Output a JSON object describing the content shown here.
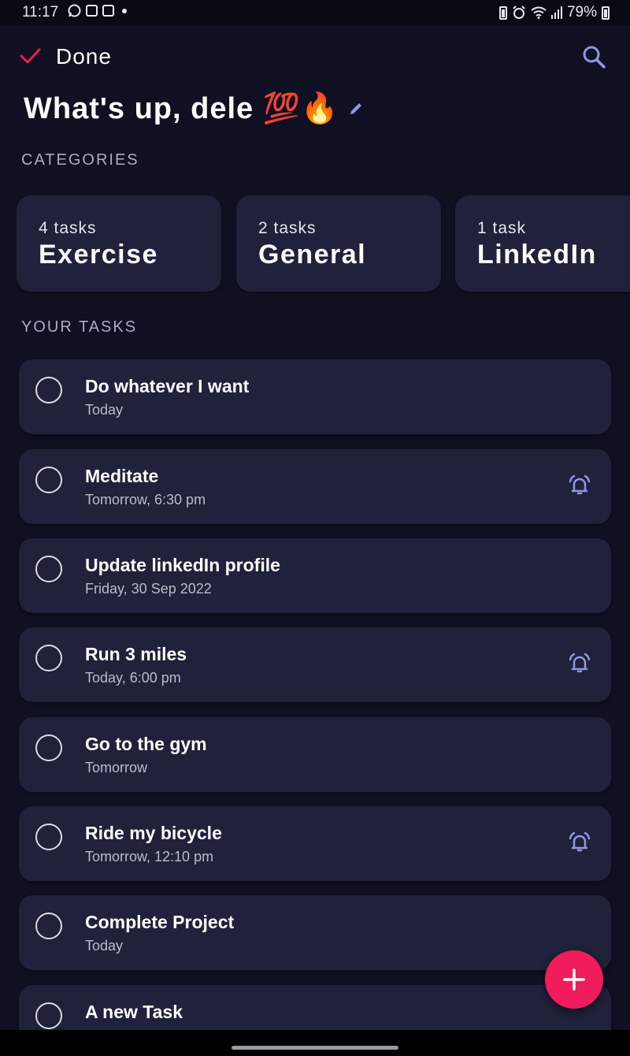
{
  "status_bar": {
    "time": "11:17",
    "battery": "79%",
    "left_icons": [
      "whatsapp-icon",
      "gallery-icon",
      "add-box-icon",
      "dot-icon"
    ],
    "right_icons": [
      "battery-saver-icon",
      "alarm-icon",
      "wifi-icon",
      "signal-icon",
      "battery-icon"
    ]
  },
  "appbar": {
    "done_label": "Done",
    "accent_color": "#f01c5c"
  },
  "greeting": {
    "text": "What's up, dele 💯🔥"
  },
  "categories": {
    "heading": "CATEGORIES",
    "items": [
      {
        "count": "4 tasks",
        "name": "Exercise"
      },
      {
        "count": "2 tasks",
        "name": "General"
      },
      {
        "count": "1 task",
        "name": "LinkedIn"
      }
    ]
  },
  "tasks": {
    "heading": "YOUR TASKS",
    "items": [
      {
        "title": "Do whatever I want",
        "date": "Today",
        "alarm": false
      },
      {
        "title": "Meditate",
        "date": "Tomorrow, 6:30 pm",
        "alarm": true
      },
      {
        "title": "Update linkedIn profile",
        "date": "Friday, 30 Sep 2022",
        "alarm": false
      },
      {
        "title": "Run 3 miles",
        "date": "Today, 6:00 pm",
        "alarm": true
      },
      {
        "title": "Go to the gym",
        "date": "Tomorrow",
        "alarm": false
      },
      {
        "title": "Ride my bicycle",
        "date": "Tomorrow, 12:10 pm",
        "alarm": true
      },
      {
        "title": "Complete Project",
        "date": "Today",
        "alarm": false
      },
      {
        "title": "A new Task",
        "date": "",
        "alarm": false
      }
    ]
  },
  "colors": {
    "background": "#0f1021",
    "card": "#20213a",
    "icon_accent": "#8f97e6",
    "fab": "#f01c5c"
  }
}
